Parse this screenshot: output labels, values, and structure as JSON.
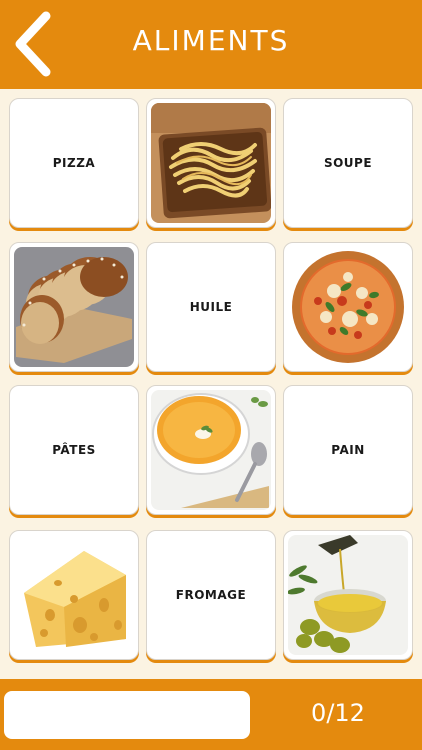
{
  "header": {
    "title": "ALIMENTS",
    "back_icon": "chevron-left-icon"
  },
  "cards": {
    "pizza_word": "PIZZA",
    "soupe_word": "SOUPE",
    "huile_word": "HUILE",
    "pates_word": "PÂTES",
    "pain_word": "PAIN",
    "fromage_word": "FROMAGE",
    "images": [
      "pasta-image",
      "bread-image",
      "pizza-image",
      "soup-image",
      "cheese-image",
      "olive-oil-image"
    ]
  },
  "footer": {
    "answer_value": "",
    "score": "0/12"
  },
  "colors": {
    "accent": "#e48a0e",
    "background": "#fbf3e2",
    "card": "#ffffff"
  }
}
